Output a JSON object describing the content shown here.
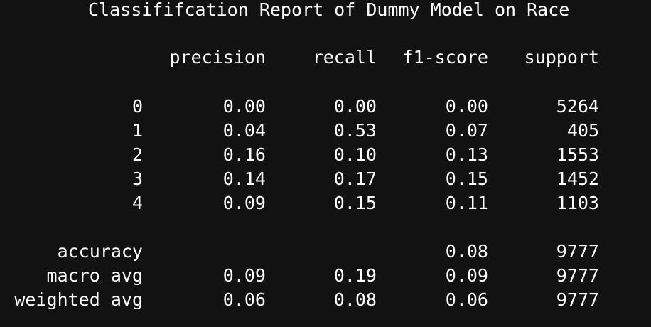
{
  "title": "Classififcation Report of Dummy Model on Race",
  "headers": {
    "precision": "precision",
    "recall": "recall",
    "f1": "f1-score",
    "support": "support"
  },
  "rows": [
    {
      "label": "0",
      "precision": "0.00",
      "recall": "0.00",
      "f1": "0.00",
      "support": "5264"
    },
    {
      "label": "1",
      "precision": "0.04",
      "recall": "0.53",
      "f1": "0.07",
      "support": "405"
    },
    {
      "label": "2",
      "precision": "0.16",
      "recall": "0.10",
      "f1": "0.13",
      "support": "1553"
    },
    {
      "label": "3",
      "precision": "0.14",
      "recall": "0.17",
      "f1": "0.15",
      "support": "1452"
    },
    {
      "label": "4",
      "precision": "0.09",
      "recall": "0.15",
      "f1": "0.11",
      "support": "1103"
    }
  ],
  "summary": [
    {
      "label": "accuracy",
      "precision": "",
      "recall": "",
      "f1": "0.08",
      "support": "9777"
    },
    {
      "label": "macro avg",
      "precision": "0.09",
      "recall": "0.19",
      "f1": "0.09",
      "support": "9777"
    },
    {
      "label": "weighted avg",
      "precision": "0.06",
      "recall": "0.08",
      "f1": "0.06",
      "support": "9777"
    }
  ]
}
